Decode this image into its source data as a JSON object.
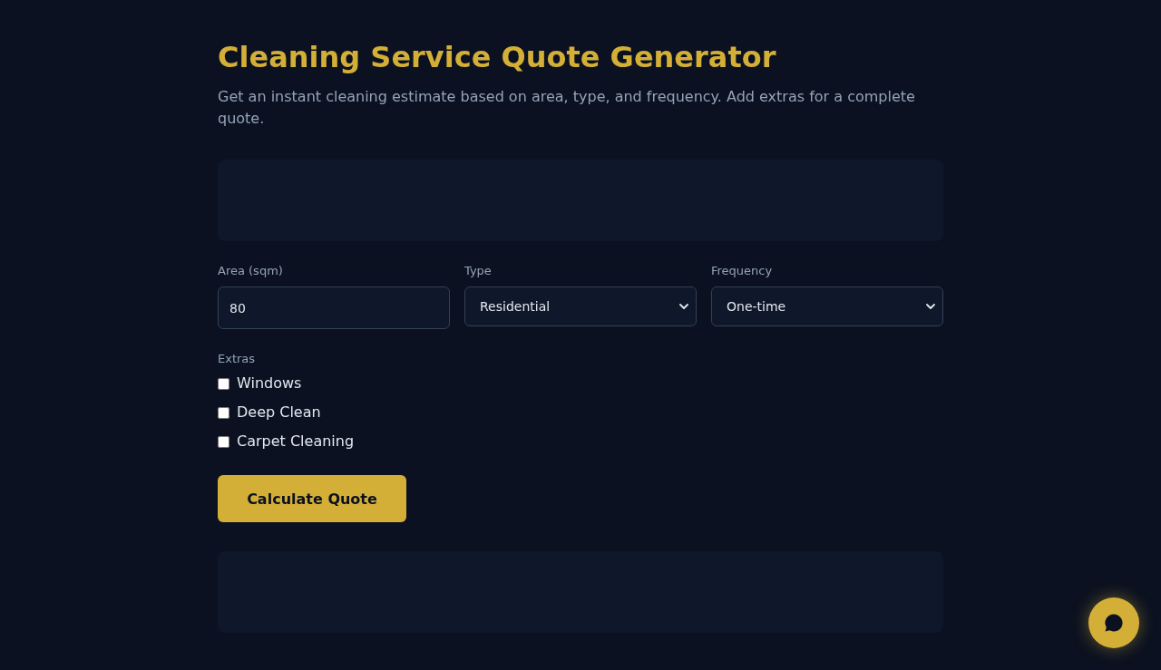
{
  "title": "Cleaning Service Quote Generator",
  "subtitle": "Get an instant cleaning estimate based on area, type, and frequency. Add extras for a complete quote.",
  "fields": [
    {
      "kind": "input",
      "label": "Area (sqm)",
      "value": "80"
    },
    {
      "kind": "select",
      "label": "Type",
      "value": "Residential"
    },
    {
      "kind": "select",
      "label": "Frequency",
      "value": "One-time"
    }
  ],
  "extras": {
    "label": "Extras",
    "options": [
      {
        "label": "Windows",
        "checked": false
      },
      {
        "label": "Deep Clean",
        "checked": false
      },
      {
        "label": "Carpet Cleaning",
        "checked": false
      }
    ]
  },
  "calculate_button": "Calculate Quote"
}
